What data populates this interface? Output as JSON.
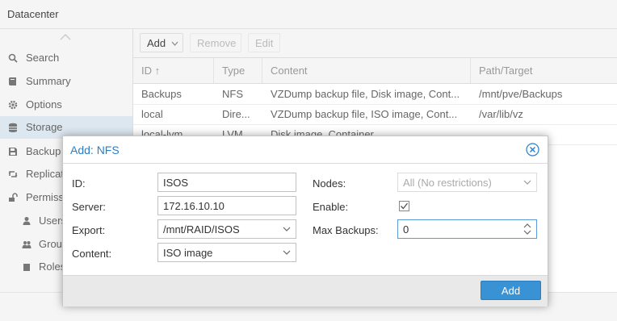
{
  "header": {
    "title": "Datacenter"
  },
  "sidebar": {
    "items": [
      {
        "label": "Search",
        "icon": "search-icon"
      },
      {
        "label": "Summary",
        "icon": "book-icon"
      },
      {
        "label": "Options",
        "icon": "gear-icon"
      },
      {
        "label": "Storage",
        "icon": "database-icon",
        "active": true
      },
      {
        "label": "Backup",
        "icon": "floppy-icon"
      },
      {
        "label": "Replicat",
        "icon": "retweet-icon"
      },
      {
        "label": "Permiss",
        "icon": "unlock-icon"
      },
      {
        "label": "Users",
        "icon": "user-icon"
      },
      {
        "label": "Grou",
        "icon": "users-icon"
      },
      {
        "label": "Roles",
        "icon": "male-icon"
      }
    ]
  },
  "toolbar": {
    "add_label": "Add",
    "remove_label": "Remove",
    "edit_label": "Edit"
  },
  "grid": {
    "columns": [
      "ID ↑",
      "Type",
      "Content",
      "Path/Target"
    ],
    "rows": [
      [
        "Backups",
        "NFS",
        "VZDump backup file, Disk image, Cont...",
        "/mnt/pve/Backups"
      ],
      [
        "local",
        "Dire...",
        "VZDump backup file, ISO image, Cont...",
        "/var/lib/vz"
      ],
      [
        "local-lvm",
        "LVM...",
        "Disk image, Container",
        ""
      ]
    ]
  },
  "dialog": {
    "title": "Add: NFS",
    "fields": {
      "id_label": "ID:",
      "id_value": "ISOS",
      "server_label": "Server:",
      "server_value": "172.16.10.10",
      "export_label": "Export:",
      "export_value": "/mnt/RAID/ISOS",
      "content_label": "Content:",
      "content_value": "ISO image",
      "nodes_label": "Nodes:",
      "nodes_value": "All (No restrictions)",
      "enable_label": "Enable:",
      "enable_checked": true,
      "maxbackups_label": "Max Backups:",
      "maxbackups_value": "0"
    },
    "add_button": "Add"
  },
  "colors": {
    "accent": "#3892d4",
    "title": "#2d7cc4",
    "active_row": "#dde7f0"
  }
}
